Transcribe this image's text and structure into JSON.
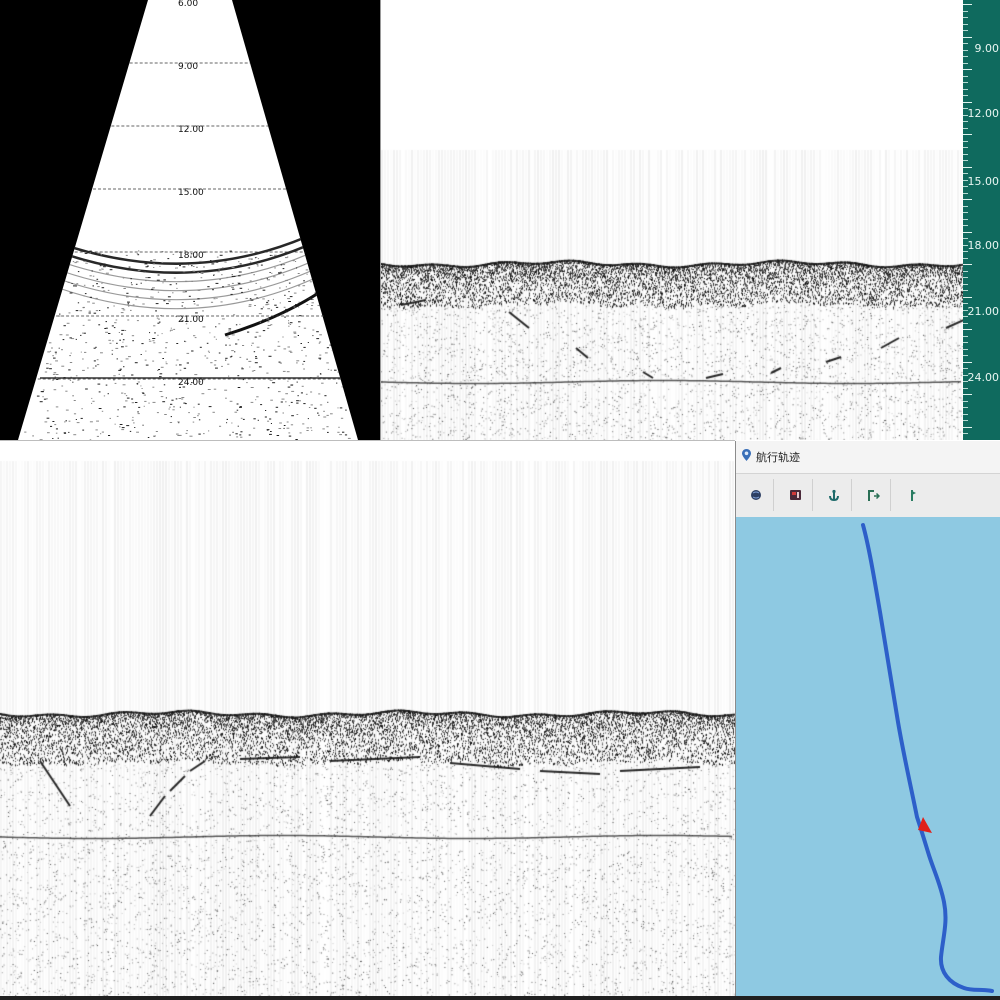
{
  "sector_display": {
    "depth_labels": [
      "6.00",
      "9.00",
      "12.00",
      "15.00",
      "18.00",
      "21.00",
      "24.00"
    ]
  },
  "depth_ruler": {
    "labels": [
      "9.00",
      "12.00",
      "15.00",
      "18.00",
      "21.00",
      "24.00"
    ],
    "color": "#0f6a5e"
  },
  "track_window": {
    "title": "航行轨迹",
    "toolbar": [
      {
        "icon": "globe-icon"
      },
      {
        "icon": "record-icon"
      },
      {
        "icon": "anchor-icon"
      },
      {
        "icon": "route-forward-icon"
      },
      {
        "icon": "marker-icon"
      }
    ],
    "map": {
      "water_color": "#8ec9e2",
      "track_color": "#2d5fc9",
      "position_marker_color": "#e0201a"
    }
  }
}
